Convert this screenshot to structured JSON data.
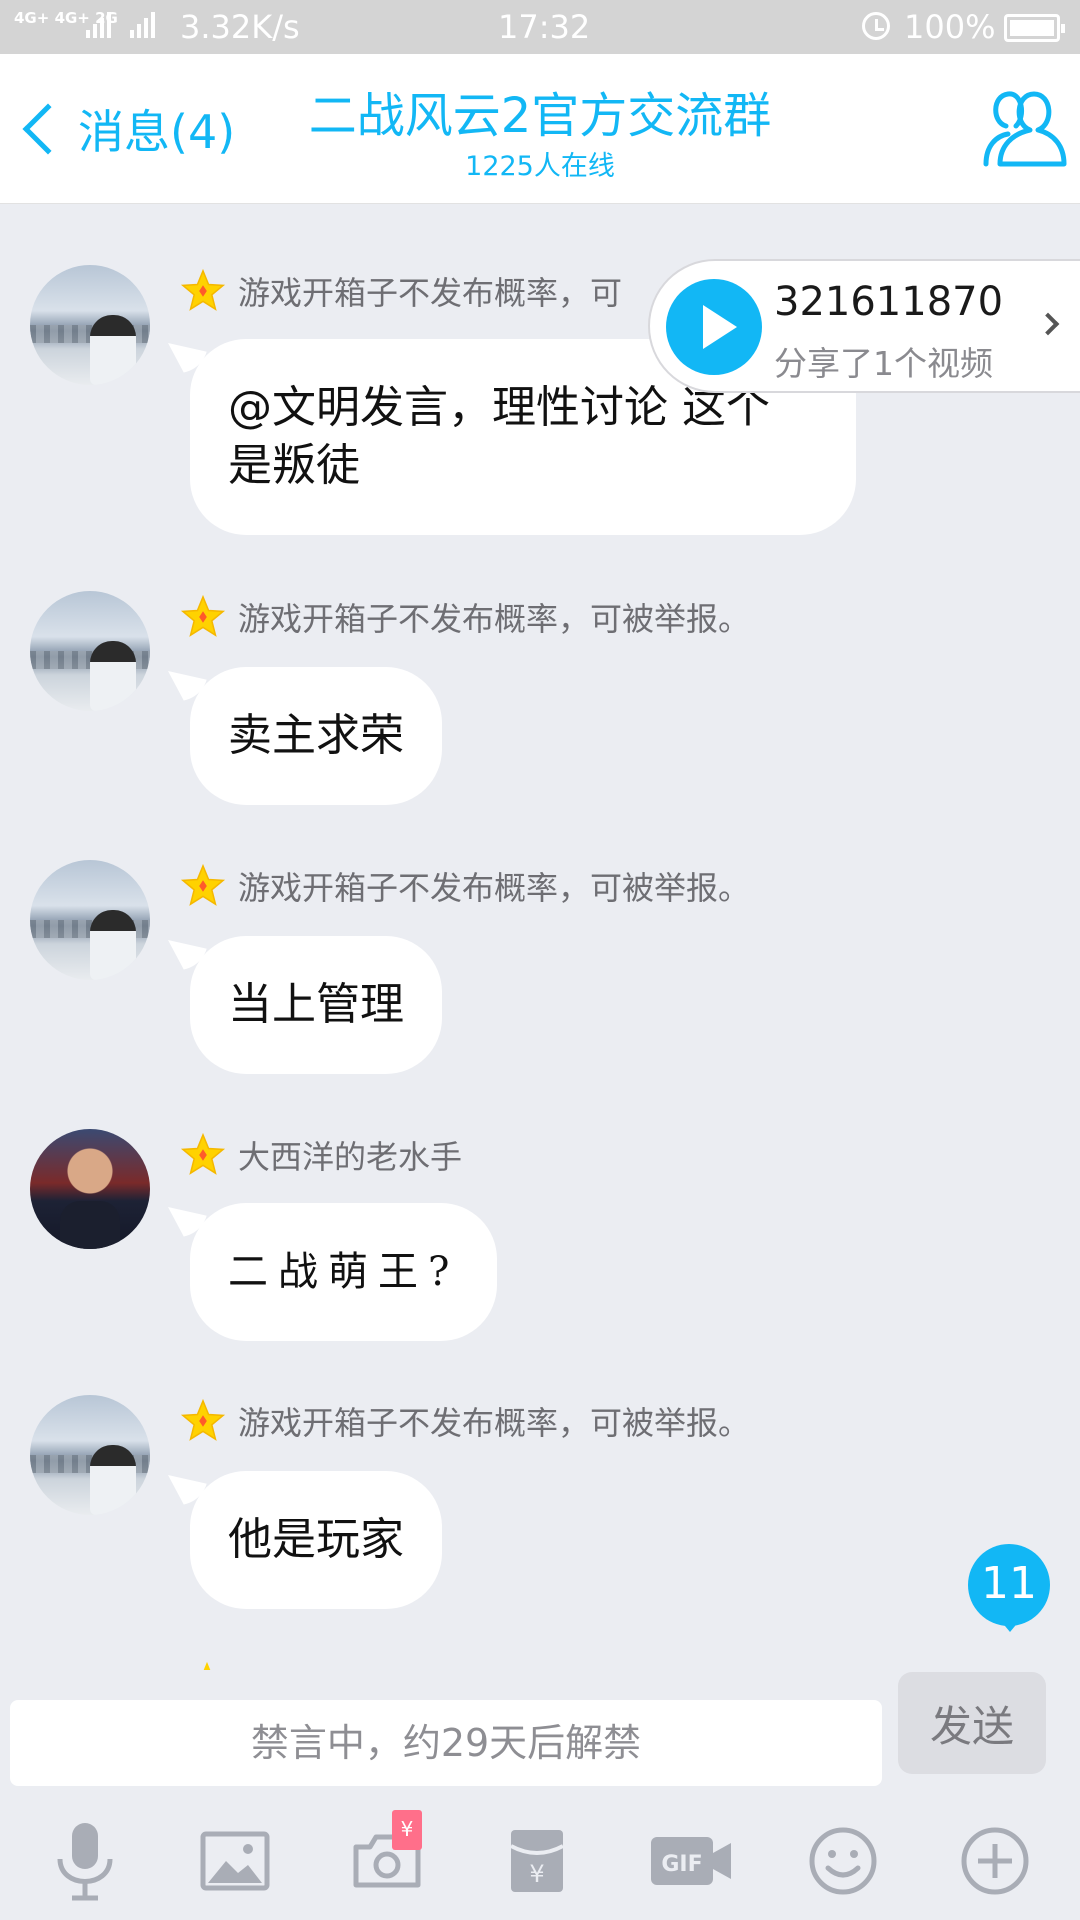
{
  "status_bar": {
    "network_1": "4G+",
    "network_2": "4G+ 2G",
    "network_3": "2G",
    "speed": "3.32K/s",
    "time": "17:32",
    "battery": "100%"
  },
  "header": {
    "back_label": "消息(4)",
    "title": "二战风云2官方交流群",
    "online": "1225人在线",
    "accent_color": "#12b7f5"
  },
  "video_share": {
    "user": "321611870",
    "description": "分享了1个视频"
  },
  "messages": [
    {
      "sender": "游戏开箱子不发布概率，可",
      "text": "@文明发言，理性讨论 这个\n是叛徒",
      "avatar": "sea-avatar"
    },
    {
      "sender": "游戏开箱子不发布概率，可被举报。",
      "text": "卖主求荣",
      "avatar": "sea-avatar"
    },
    {
      "sender": "游戏开箱子不发布概率，可被举报。",
      "text": "当上管理",
      "avatar": "sea-avatar"
    },
    {
      "sender": "大西洋的老水手",
      "text": "二战萌王?",
      "avatar": "admiral-avatar"
    },
    {
      "sender": "游戏开箱子不发布概率，可被举报。",
      "text": "他是玩家",
      "avatar": "sea-avatar"
    }
  ],
  "unread_count": "11",
  "input": {
    "placeholder": "禁言中，约29天后解禁",
    "send_label": "发送"
  },
  "toolbar": {
    "items": [
      "microphone-icon",
      "image-icon",
      "camera-icon",
      "red-packet-icon",
      "gif-icon",
      "emoji-icon",
      "plus-icon"
    ],
    "camera_badge": "¥"
  }
}
